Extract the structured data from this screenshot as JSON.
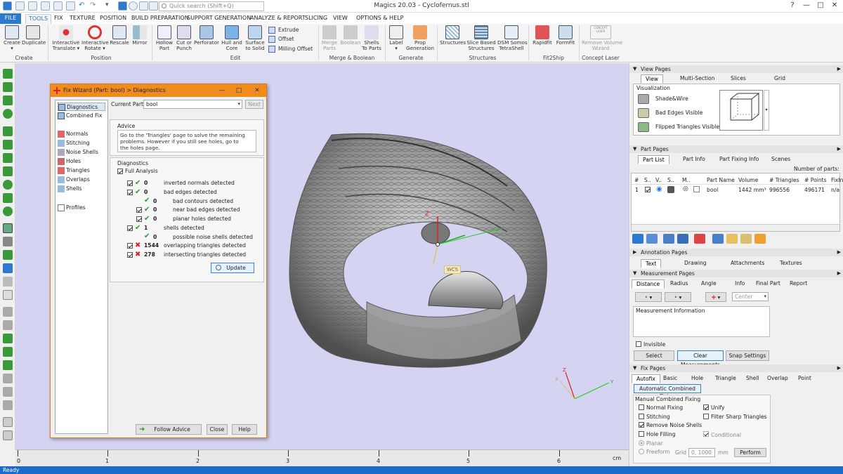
{
  "titlebar": {
    "search_placeholder": "Quick search (Shift+Q)",
    "app_title": "Magics 20.03 - Cyclofernus.stl",
    "help": "?",
    "minimize": "—",
    "maximize": "□",
    "close": "✕"
  },
  "menu": {
    "file": "FILE",
    "tabs": [
      "TOOLS",
      "FIX",
      "TEXTURE",
      "POSITION",
      "BUILD PREPARATION",
      "SUPPORT GENERATION",
      "ANALYZE & REPORT",
      "SLICING",
      "VIEW",
      "OPTIONS & HELP"
    ]
  },
  "ribbon": {
    "buttons": [
      {
        "label": "Create\n▾",
        "icon": "create-icon"
      },
      {
        "label": "Duplicate",
        "icon": "duplicate-icon"
      },
      {
        "label": "Interactive\nTranslate ▾",
        "icon": "translate-icon"
      },
      {
        "label": "Interactive\nRotate ▾",
        "icon": "rotate-icon"
      },
      {
        "label": "Rescale",
        "icon": "rescale-icon"
      },
      {
        "label": "Mirror",
        "icon": "mirror-icon"
      },
      {
        "label": "Hollow\nPart",
        "icon": "hollow-icon"
      },
      {
        "label": "Cut or\nPunch",
        "icon": "cut-icon"
      },
      {
        "label": "Perforator",
        "icon": "perforator-icon"
      },
      {
        "label": "Hull and\nCore",
        "icon": "hull-icon"
      },
      {
        "label": "Surface\nto Solid",
        "icon": "surface-icon"
      },
      {
        "label": "Merge\nParts",
        "icon": "merge-icon"
      },
      {
        "label": "Boolean",
        "icon": "boolean-icon"
      },
      {
        "label": "Shells\nTo Parts",
        "icon": "shells-icon"
      },
      {
        "label": "Label\n▾",
        "icon": "label-icon"
      },
      {
        "label": "Prop\nGeneration",
        "icon": "prop-icon"
      },
      {
        "label": "Structures",
        "icon": "structures-icon"
      },
      {
        "label": "Slice Based\nStructures",
        "icon": "slice-structures-icon"
      },
      {
        "label": "DSM Somos\nTetraShell",
        "icon": "tetrashell-icon"
      },
      {
        "label": "Rapidfit",
        "icon": "rapidfit-icon"
      },
      {
        "label": "FormFit",
        "icon": "formfit-icon"
      },
      {
        "label": "Remove Volume\nWizard",
        "icon": "remove-volume-icon"
      }
    ],
    "small_buttons": [
      "Extrude",
      "Offset",
      "Milling Offset"
    ],
    "groups": [
      "Create",
      "Position",
      "Edit",
      "Merge & Boolean",
      "Generate",
      "Structures",
      "Fit2Ship",
      "Concept Laser"
    ],
    "concept_badge": "CONCEPT\nLASER"
  },
  "viewport": {
    "wcs_label": "WCS",
    "axis_z": "Z",
    "axis_y": "Y",
    "axis_x": "X",
    "ruler_labels": [
      "0",
      "1",
      "2",
      "3",
      "4",
      "5",
      "6"
    ],
    "ruler_unit": "cm"
  },
  "status": "Ready",
  "fixwizard": {
    "title": "Fix Wizard (Part: bool) > Diagnostics",
    "nav": [
      {
        "label": "Diagnostics",
        "icon": "diagnostics-icon",
        "selected": true
      },
      {
        "label": "Combined Fix",
        "icon": "combined-fix-icon"
      },
      {
        "label": "Normals",
        "icon": "normals-icon"
      },
      {
        "label": "Stitching",
        "icon": "stitching-icon"
      },
      {
        "label": "Noise Shells",
        "icon": "noise-shells-icon"
      },
      {
        "label": "Holes",
        "icon": "holes-icon"
      },
      {
        "label": "Triangles",
        "icon": "triangles-icon"
      },
      {
        "label": "Overlaps",
        "icon": "overlaps-icon"
      },
      {
        "label": "Shells",
        "icon": "shells-icon"
      },
      {
        "label": "Profiles",
        "icon": "profiles-icon"
      }
    ],
    "current_part_label": "Current Part:",
    "current_part": "bool",
    "next": "Next",
    "advice_title": "Advice",
    "advice_text": "Go to the 'Triangles' page to solve the remaining problems. However if you still see holes, go to the holes page.",
    "diagnostics_title": "Diagnostics",
    "full_analysis": "Full Analysis",
    "rows": [
      {
        "value": "0",
        "text": "inverted normals detected",
        "ok": true,
        "indent": 0
      },
      {
        "value": "0",
        "text": "bad edges detected",
        "ok": true,
        "indent": 0
      },
      {
        "value": "0",
        "text": "bad contours detected",
        "ok": true,
        "indent": 1
      },
      {
        "value": "0",
        "text": "near bad edges detected",
        "ok": true,
        "indent": 1
      },
      {
        "value": "0",
        "text": "planar holes detected",
        "ok": true,
        "indent": 1
      },
      {
        "value": "1",
        "text": "shells detected",
        "ok": true,
        "indent": 0
      },
      {
        "value": "0",
        "text": "possible noise shells detected",
        "ok": true,
        "indent": 1
      },
      {
        "value": "1544",
        "text": "overlapping triangles detected",
        "ok": false,
        "indent": 0
      },
      {
        "value": "278",
        "text": "intersecting triangles detected",
        "ok": false,
        "indent": 0
      }
    ],
    "update": "Update",
    "follow_advice": "Follow Advice",
    "close": "Close",
    "help": "Help"
  },
  "view_pages": {
    "title": "View Pages",
    "tabs": [
      "View",
      "Multi-Section",
      "Slices",
      "Grid"
    ],
    "visualization": "Visualization",
    "options": [
      "Shade&Wire",
      "Bad Edges Visible",
      "Flipped Triangles Visible"
    ]
  },
  "part_pages": {
    "title": "Part Pages",
    "tabs": [
      "Part List",
      "Part Info",
      "Part Fixing Info",
      "Scenes"
    ],
    "count_label": "Number of parts: 1",
    "columns": [
      "#",
      "S..",
      "V..",
      "S..",
      "M..",
      "Part Name",
      "Volume",
      "# Triangles",
      "# Points",
      "FixInfo"
    ],
    "rows": [
      [
        "1",
        "",
        "",
        "",
        "",
        "bool",
        "1442 mm³",
        "996556",
        "496171",
        "n/a"
      ]
    ]
  },
  "annotation_pages": {
    "title": "Annotation Pages",
    "tabs": [
      "Text",
      "Drawing",
      "Attachments",
      "Textures"
    ]
  },
  "measurement_pages": {
    "title": "Measurement Pages",
    "tabs": [
      "Distance",
      "Radius",
      "Angle",
      "Info",
      "Final Part",
      "Report"
    ],
    "center": "Center",
    "info_label": "Measurement Information",
    "invisible": "Invisible",
    "select": "Select",
    "clear": "Clear Measurements",
    "snap": "Snap Settings"
  },
  "fix_pages": {
    "title": "Fix Pages",
    "tabs": [
      "Autofix",
      "Basic",
      "Hole",
      "Triangle",
      "Shell",
      "Overlap",
      "Point"
    ],
    "auto_combined": "Automatic Combined Fixing",
    "manual_label": "Manual Combined Fixing",
    "checks": [
      {
        "label": "Normal Fixing",
        "on": false
      },
      {
        "label": "Unify",
        "on": true
      },
      {
        "label": "Stitching",
        "on": false
      },
      {
        "label": "Filter Sharp Triangles",
        "on": false
      },
      {
        "label": "Remove Noise Shells",
        "on": true
      },
      {
        "label": "Hole Filling",
        "on": false
      },
      {
        "label": "Conditional",
        "on": true
      }
    ],
    "planar": "Planar",
    "freeform": "Freeform",
    "grid_label": "Grid",
    "grid_value": "0, 1000",
    "grid_unit": "mm",
    "perform": "Perform"
  },
  "colors": {
    "accent": "#2b79d0",
    "wizard_title": "#f08c1e",
    "viewport_bg": "#d4d4f2",
    "ok": "#2a9a2a",
    "error": "#d22222"
  }
}
